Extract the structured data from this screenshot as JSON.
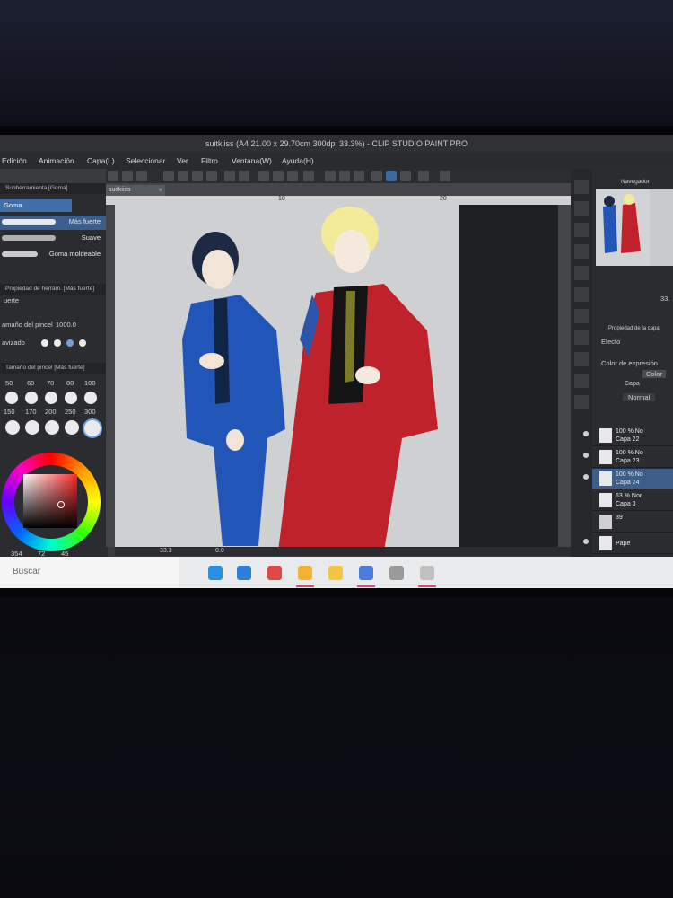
{
  "window": {
    "title": "suitkiiss (A4 21.00 x 29.70cm 300dpi 33.3%) - CLIP STUDIO PAINT PRO"
  },
  "menu": [
    "Edición",
    "Animación",
    "Capa(L)",
    "Seleccionar",
    "Ver",
    "Filtro",
    "Ventana(W)",
    "Ayuda(H)"
  ],
  "left_panel": {
    "subtool_header": "Subherramienta [Goma]",
    "subtool_tab": "Goma",
    "brushes": [
      "Más fuerte",
      "Suave",
      "Goma moldeable"
    ],
    "tool_property_header": "Propiedad de herram. [Más fuerte]",
    "tool_property_item": "uerte",
    "brush_size_label": "amaño del pincel",
    "brush_size_value": "1000.0",
    "antialias_label": "avizado",
    "brush_size_panel_header": "Tamaño del pincel [Más fuerte]",
    "size_row1": [
      "50",
      "60",
      "70",
      "80",
      "100"
    ],
    "size_row2": [
      "150",
      "170",
      "200",
      "250",
      "300"
    ],
    "color_info": [
      "354",
      "72",
      "45"
    ]
  },
  "document_tab": "suitkiiss",
  "ruler_marks": [
    "10",
    "20"
  ],
  "status": {
    "zoom": "33.3",
    "angle": "0.0"
  },
  "right_panel": {
    "navigator_label": "Navegador",
    "nav_zoom": "33.",
    "layer_property_label": "Propiedad de la capa",
    "effect_label": "Efecto",
    "expression_color_label": "Color de expresión",
    "color_button": "Color",
    "layer_tab": "Capa",
    "blend_mode": "Normal",
    "layers": [
      {
        "opacity": "100 % No",
        "name": "Capa 22"
      },
      {
        "opacity": "100 % No",
        "name": "Capa 23"
      },
      {
        "opacity": "100 % No",
        "name": "Capa 24"
      },
      {
        "opacity": "63 % Nor",
        "name": "Capa 3"
      },
      {
        "opacity": "39",
        "name": ""
      },
      {
        "opacity": "",
        "name": "Pape"
      }
    ]
  },
  "taskbar": {
    "search_placeholder": "Buscar"
  },
  "colors": {
    "accent": "#3f6fa8",
    "blue_suit": "#2255b8",
    "red_suit": "#c0222c"
  }
}
